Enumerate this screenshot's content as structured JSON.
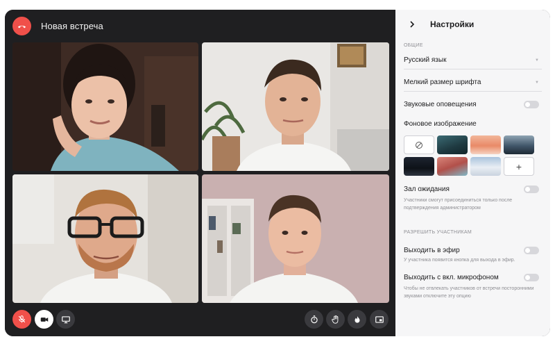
{
  "call": {
    "title": "Новая встреча",
    "participants": [
      {
        "name": "participant-1"
      },
      {
        "name": "participant-2"
      },
      {
        "name": "participant-3"
      },
      {
        "name": "participant-4"
      }
    ]
  },
  "toolbar": {
    "mic_state": "muted",
    "camera_state": "on",
    "buttons": [
      "mic-off-icon",
      "camera-icon",
      "screen-share-icon",
      "timer-icon",
      "raise-hand-icon",
      "reaction-fire-icon",
      "picture-in-picture-icon"
    ]
  },
  "settings": {
    "title": "Настройки",
    "general_label": "ОБЩИЕ",
    "language": "Русский язык",
    "font_size": "Мелкий размер шрифта",
    "sound_alerts": "Звуковые оповещения",
    "background_label": "Фоновое изображение",
    "waiting_room": "Зал ожидания",
    "waiting_room_hint": "Участники смогут присоединиться только после подтверждения администратором",
    "allow_label": "РАЗРЕШИТЬ УЧАСТНИКАМ",
    "broadcast": "Выходить в эфир",
    "broadcast_hint": "У участника появится кнопка для выхода в эфир.",
    "mic_on": "Выходить с вкл. микрофоном",
    "mic_on_hint": "Чтобы не отвлекать участников от встречи посторонними звуками отключите эту опцию"
  },
  "colors": {
    "danger": "#f0504a",
    "call_bg": "#1f1f21",
    "panel_bg": "#f6f6f7",
    "button_dark": "#3a3a3e"
  }
}
